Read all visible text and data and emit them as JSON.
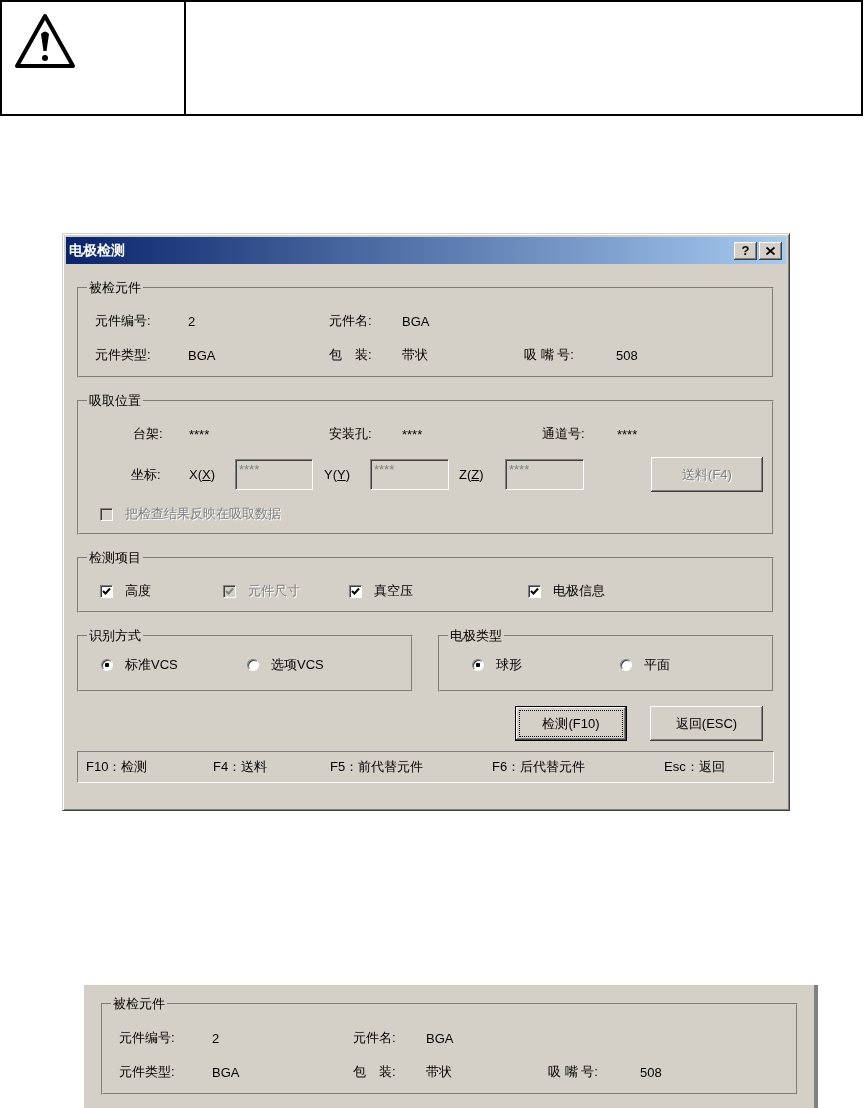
{
  "dialog": {
    "title": "电极检测",
    "help_button": "?",
    "component_group": {
      "title": "被检元件",
      "rows": [
        [
          {
            "label": "元件编号:",
            "value": "2"
          },
          {
            "label": "元件名:",
            "value": "BGA"
          }
        ],
        [
          {
            "label": "元件类型:",
            "value": "BGA"
          },
          {
            "label": "包　装:",
            "value": "带状"
          },
          {
            "label": "吸 嘴 号:",
            "value": "508"
          }
        ]
      ]
    },
    "pickup_group": {
      "title": "吸取位置",
      "fields": [
        {
          "label": "台架:",
          "value": "****"
        },
        {
          "label": "安装孔:",
          "value": "****"
        },
        {
          "label": "通道号:",
          "value": "****"
        }
      ],
      "coords_label": "坐标:",
      "coords": [
        {
          "label_before": "X(",
          "mnemonic": "X",
          "label_after": ")",
          "value": "****",
          "disabled": true
        },
        {
          "label_before": "Y(",
          "mnemonic": "Y",
          "label_after": ")",
          "value": "****",
          "disabled": true
        },
        {
          "label_before": "Z(",
          "mnemonic": "Z",
          "label_after": ")",
          "value": "****",
          "disabled": true
        }
      ],
      "feed_button": {
        "label": "送料(F4)",
        "disabled": true
      },
      "reflect": {
        "label": "把检查结果反映在吸取数据",
        "checked": false,
        "disabled": true
      }
    },
    "items_group": {
      "title": "检测项目",
      "checkboxes": [
        {
          "label": "高度",
          "checked": true,
          "disabled": false
        },
        {
          "label": "元件尺寸",
          "checked": true,
          "disabled": true
        },
        {
          "label": "真空压",
          "checked": true,
          "disabled": false
        },
        {
          "label": "电极信息",
          "checked": true,
          "disabled": false
        }
      ]
    },
    "recognition_group": {
      "title": "识别方式",
      "options": [
        {
          "label": "标准VCS",
          "selected": true
        },
        {
          "label": "选项VCS",
          "selected": false
        }
      ]
    },
    "electrode_group": {
      "title": "电极类型",
      "options": [
        {
          "label": "球形",
          "selected": true
        },
        {
          "label": "平面",
          "selected": false
        }
      ]
    },
    "buttons": [
      {
        "label": "检测(F10)",
        "default": true
      },
      {
        "label": "返回(ESC)",
        "default": false
      }
    ],
    "status_bar": [
      "F10：检测",
      "F4：送料",
      "F5：前代替元件",
      "F6：后代替元件",
      "Esc：返回"
    ]
  },
  "detail_panel": {
    "title": "被检元件",
    "rows": [
      [
        {
          "label": "元件编号:",
          "value": "2"
        },
        {
          "label": "元件名:",
          "value": "BGA"
        }
      ],
      [
        {
          "label": "元件类型:",
          "value": "BGA"
        },
        {
          "label": "包　装:",
          "value": "带状"
        },
        {
          "label": "吸 嘴 号:",
          "value": "508"
        }
      ]
    ]
  }
}
